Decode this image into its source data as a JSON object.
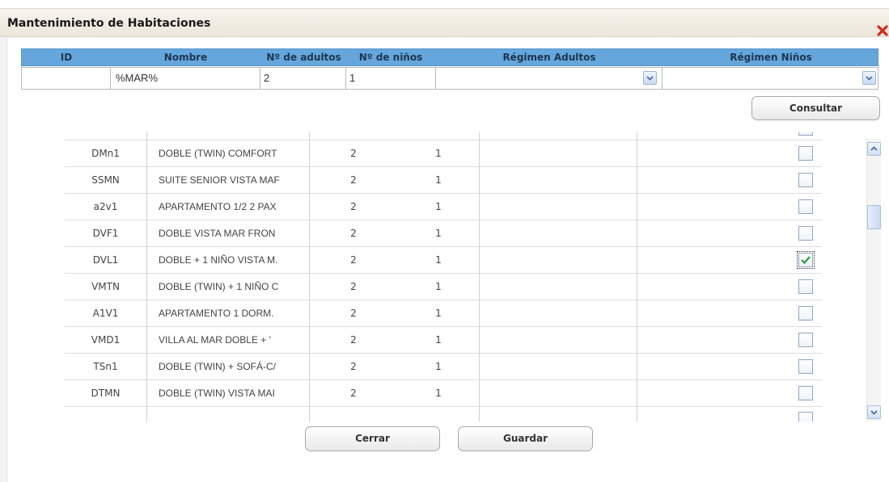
{
  "dialog": {
    "title": "Mantenimiento de Habitaciones"
  },
  "filter": {
    "headers": {
      "id": "ID",
      "nombre": "Nombre",
      "adultos": "Nº de adultos",
      "ninos": "Nº de niños",
      "regimen_adultos": "Régimen Adultos",
      "regimen_ninos": "Régimen Niños"
    },
    "values": {
      "id": "",
      "nombre": "%MAR%",
      "adultos": "2",
      "ninos": "1",
      "regimen_adultos": "",
      "regimen_ninos": ""
    }
  },
  "buttons": {
    "consultar": "Consultar",
    "cerrar": "Cerrar",
    "guardar": "Guardar"
  },
  "rows": [
    {
      "code": "DMn1",
      "name": "DOBLE (TWIN) COMFORT",
      "adults": "2",
      "children": "1",
      "checked": false
    },
    {
      "code": "SSMN",
      "name": "SUITE SENIOR VISTA MAF",
      "adults": "2",
      "children": "1",
      "checked": false
    },
    {
      "code": "a2v1",
      "name": "APARTAMENTO 1/2 2 PAX",
      "adults": "2",
      "children": "1",
      "checked": false
    },
    {
      "code": "DVF1",
      "name": "DOBLE VISTA MAR FRON",
      "adults": "2",
      "children": "1",
      "checked": false
    },
    {
      "code": "DVL1",
      "name": "DOBLE + 1 NIÑO VISTA M.",
      "adults": "2",
      "children": "1",
      "checked": true
    },
    {
      "code": "VMTN",
      "name": "DOBLE (TWIN) + 1 NIÑO C",
      "adults": "2",
      "children": "1",
      "checked": false
    },
    {
      "code": "A1V1",
      "name": "APARTAMENTO 1 DORM.",
      "adults": "2",
      "children": "1",
      "checked": false
    },
    {
      "code": "VMD1",
      "name": "VILLA AL MAR DOBLE + '",
      "adults": "2",
      "children": "1",
      "checked": false
    },
    {
      "code": "TSn1",
      "name": "DOBLE (TWIN) + SOFÁ-C/",
      "adults": "2",
      "children": "1",
      "checked": false
    },
    {
      "code": "DTMN",
      "name": "DOBLE (TWIN) VISTA MAI",
      "adults": "2",
      "children": "1",
      "checked": false
    }
  ],
  "colors": {
    "header_blue": "#65a7dc",
    "check_green": "#2e9a3a",
    "close_red": "#d42b1e"
  }
}
